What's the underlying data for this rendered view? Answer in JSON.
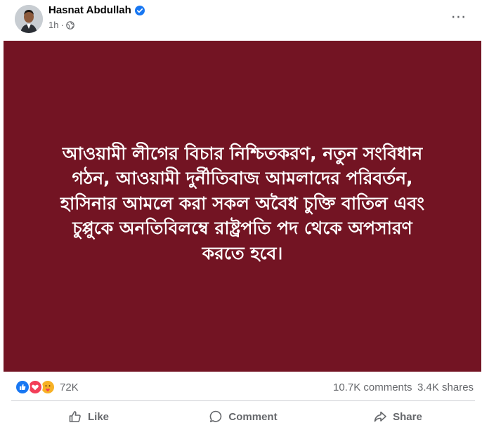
{
  "post": {
    "author": "Hasnat Abdullah",
    "time": "1h",
    "more_icon": "⋯",
    "text_lines": [
      "আওয়ামী লীগের বিচার নিশ্চিতকরণ, নতুন সংবিধান",
      "গঠন, আওয়ামী দুর্নীতিবাজ আমলাদের পরিবর্তন,",
      "হাসিনার আমলে করা সকল অবৈধ চুক্তি বাতিল এবং",
      "চুপ্পুকে অনতিবিলম্বে রাষ্ট্রপতি পদ থেকে অপসারণ",
      "করতে হবে।"
    ],
    "background_color": "#731423"
  },
  "stats": {
    "reactions_count": "72K",
    "comments": "10.7K comments",
    "shares": "3.4K shares"
  },
  "actions": {
    "like": "Like",
    "comment": "Comment",
    "share": "Share"
  },
  "colors": {
    "like_blue": "#1877f2",
    "love_red": "#f33e58",
    "care_yellow": "#f7b125",
    "muted_text": "#65676b"
  }
}
